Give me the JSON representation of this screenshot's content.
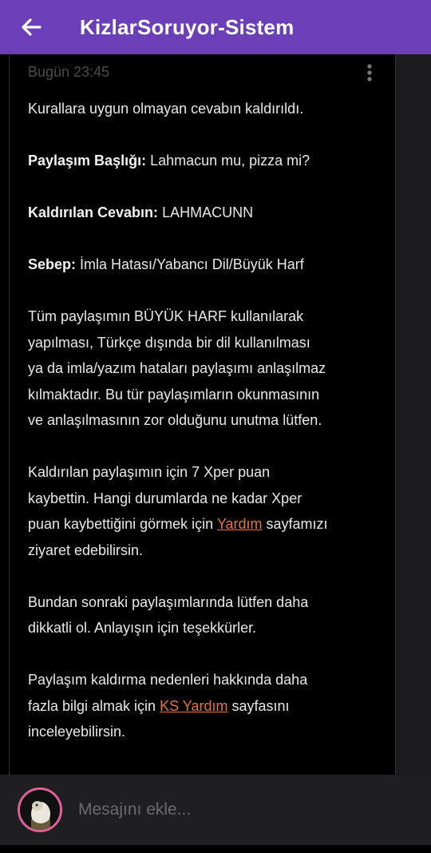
{
  "header": {
    "title": "KizlarSoruyor-Sistem",
    "back_icon": "arrow-left-icon"
  },
  "message": {
    "timestamp": "Bugün 23:45",
    "more_icon": "more-vertical-icon",
    "intro": "Kurallara uygun olmayan cevabın kaldırıldı.",
    "post_title_label": "Paylaşım Başlığı:",
    "post_title_value": "Lahmacun mu, pizza mi?",
    "removed_answer_label": "Kaldırılan Cevabın:",
    "removed_answer_value": "LAHMACUNN",
    "reason_label": "Sebep:",
    "reason_value": "İmla Hatası/Yabancı Dil/Büyük Harf",
    "explanation_lines": [
      "Tüm paylaşımın BÜYÜK HARF kullanılarak",
      "yapılması, Türkçe dışında bir dil kullanılması",
      "ya da imla/yazım hataları paylaşımı anlaşılmaz",
      "kılmaktadır. Bu tür paylaşımların okunmasının",
      "ve anlaşılmasının zor olduğunu unutma lütfen."
    ],
    "xper": {
      "line1": "Kaldırılan paylaşımın için 7 Xper puan",
      "line2": "kaybettin. Hangi durumlarda ne kadar Xper",
      "line3_before": "puan kaybettiğini görmek için",
      "link": "Yardım",
      "line3_after": "sayfamızı",
      "line4": "ziyaret edebilirsin."
    },
    "closing_lines": [
      "Bundan sonraki paylaşımlarında lütfen daha",
      "dikkatli ol. Anlayışın için teşekkürler."
    ],
    "more_info": {
      "line1": "Paylaşım kaldırma nedenleri hakkında daha",
      "line2_before": "fazla bilgi almak için",
      "link": "KS Yardım",
      "line2_after": "sayfasını",
      "line3": "inceleyebilirsin."
    }
  },
  "composer": {
    "placeholder": "Mesajını ekle...",
    "avatar_icon": "user-avatar"
  },
  "colors": {
    "appbar": "#6a3fb8",
    "link": "#e8733a",
    "avatar_ring": "#e0609a",
    "background": "#000000",
    "composer": "#1f1f21"
  }
}
